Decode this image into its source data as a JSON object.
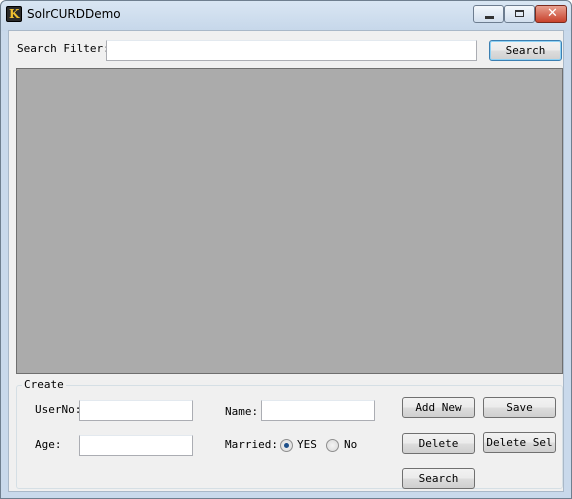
{
  "window": {
    "title": "SolrCURDDemo"
  },
  "search": {
    "label": "Search Filter:",
    "value": "",
    "button": "Search"
  },
  "create": {
    "group_title": "Create",
    "userno_label": "UserNo:",
    "userno_value": "",
    "age_label": "Age:",
    "age_value": "",
    "name_label": "Name:",
    "name_value": "",
    "married_label": "Married:",
    "married_yes": "YES",
    "married_no": "No",
    "married_selected": "YES"
  },
  "actions": {
    "add_new": "Add New",
    "save": "Save",
    "delete": "Delete",
    "delete_sel": "Delete Sel",
    "search": "Search"
  }
}
